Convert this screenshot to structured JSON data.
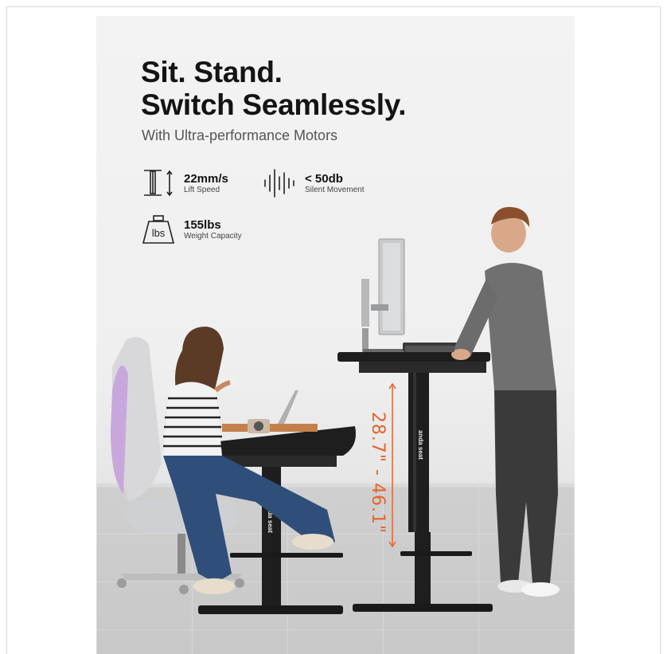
{
  "headline": {
    "line1": "Sit. Stand.",
    "line2": "Switch Seamlessly."
  },
  "subheadline": "With Ultra-performance Motors",
  "specs": {
    "lift_speed": {
      "value": "22mm/s",
      "label": "Lift Speed",
      "icon": "lift-column-icon"
    },
    "noise": {
      "value": "< 50db",
      "label": "Silent Movement",
      "icon": "sound-wave-icon"
    },
    "capacity": {
      "value": "155lbs",
      "label": "Weight Capacity",
      "icon": "weight-icon",
      "icon_text": "lbs"
    }
  },
  "height_range": "28.7\" - 46.1\"",
  "desk_brand": "anda seat",
  "colors": {
    "accent": "#e8622a",
    "desk": "#1e1e1e",
    "text": "#141414"
  }
}
